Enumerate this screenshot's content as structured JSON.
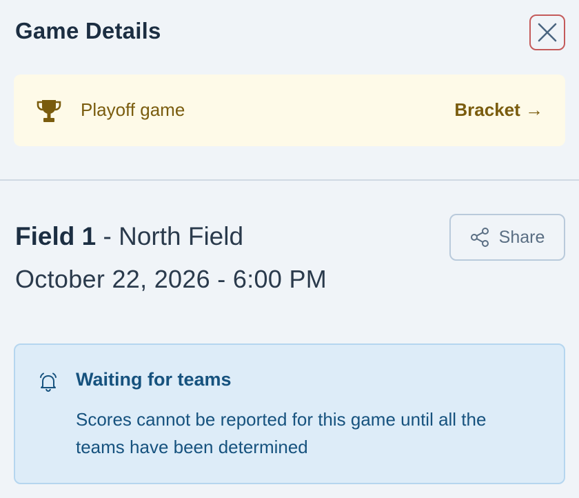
{
  "header": {
    "title": "Game Details",
    "close_icon": "close-icon"
  },
  "playoff": {
    "icon": "trophy-icon",
    "label": "Playoff game",
    "link_label": "Bracket →"
  },
  "game": {
    "field_name": "Field 1",
    "separator": " - ",
    "location": "North Field",
    "datetime": "October 22, 2026 - 6:00 PM",
    "share_label": "Share",
    "share_icon": "share-icon"
  },
  "notice": {
    "icon": "bell-icon",
    "title": "Waiting for teams",
    "body": "Scores cannot be reported for this game until all the teams have been determined"
  },
  "colors": {
    "background": "#f0f4f8",
    "playoff_bg": "#fefae8",
    "playoff_text": "#7a5c0e",
    "notice_bg": "#ddecf8",
    "notice_text": "#16527e",
    "close_border": "#c45a5a"
  }
}
